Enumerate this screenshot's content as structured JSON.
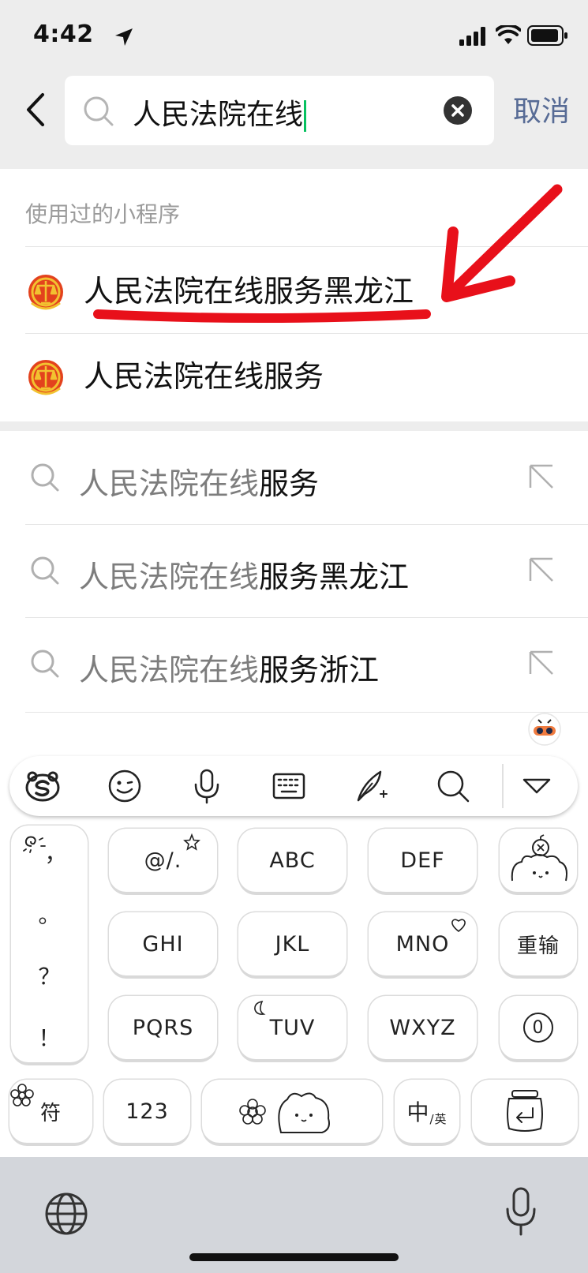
{
  "status_bar": {
    "time": "4:42"
  },
  "search": {
    "query": "人民法院在线",
    "cancel_label": "取消"
  },
  "mini_programs": {
    "section_title": "使用过的小程序",
    "items": [
      {
        "label": "人民法院在线服务黑龙江"
      },
      {
        "label": "人民法院在线服务"
      }
    ]
  },
  "suggestions": [
    {
      "prefix": "人民法院在线",
      "suffix": "服务"
    },
    {
      "prefix": "人民法院在线",
      "suffix": "服务黑龙江"
    },
    {
      "prefix": "人民法院在线",
      "suffix": "服务浙江"
    }
  ],
  "keyboard": {
    "punctuation": [
      "，",
      "。",
      "？",
      "！"
    ],
    "keys": {
      "at": "@/.",
      "abc": "ABC",
      "def": "DEF",
      "ghi": "GHI",
      "jkl": "JKL",
      "mno": "MNO",
      "reinput": "重输",
      "pqrs": "PQRS",
      "tuv": "TUV",
      "wxyz": "WXYZ",
      "zero": "0",
      "symbol": "符",
      "num": "123",
      "lang_main": "中",
      "lang_sub": "/英"
    }
  },
  "colors": {
    "accent": "#576b95",
    "annotation": "#e8101a",
    "caret": "#07c160"
  }
}
